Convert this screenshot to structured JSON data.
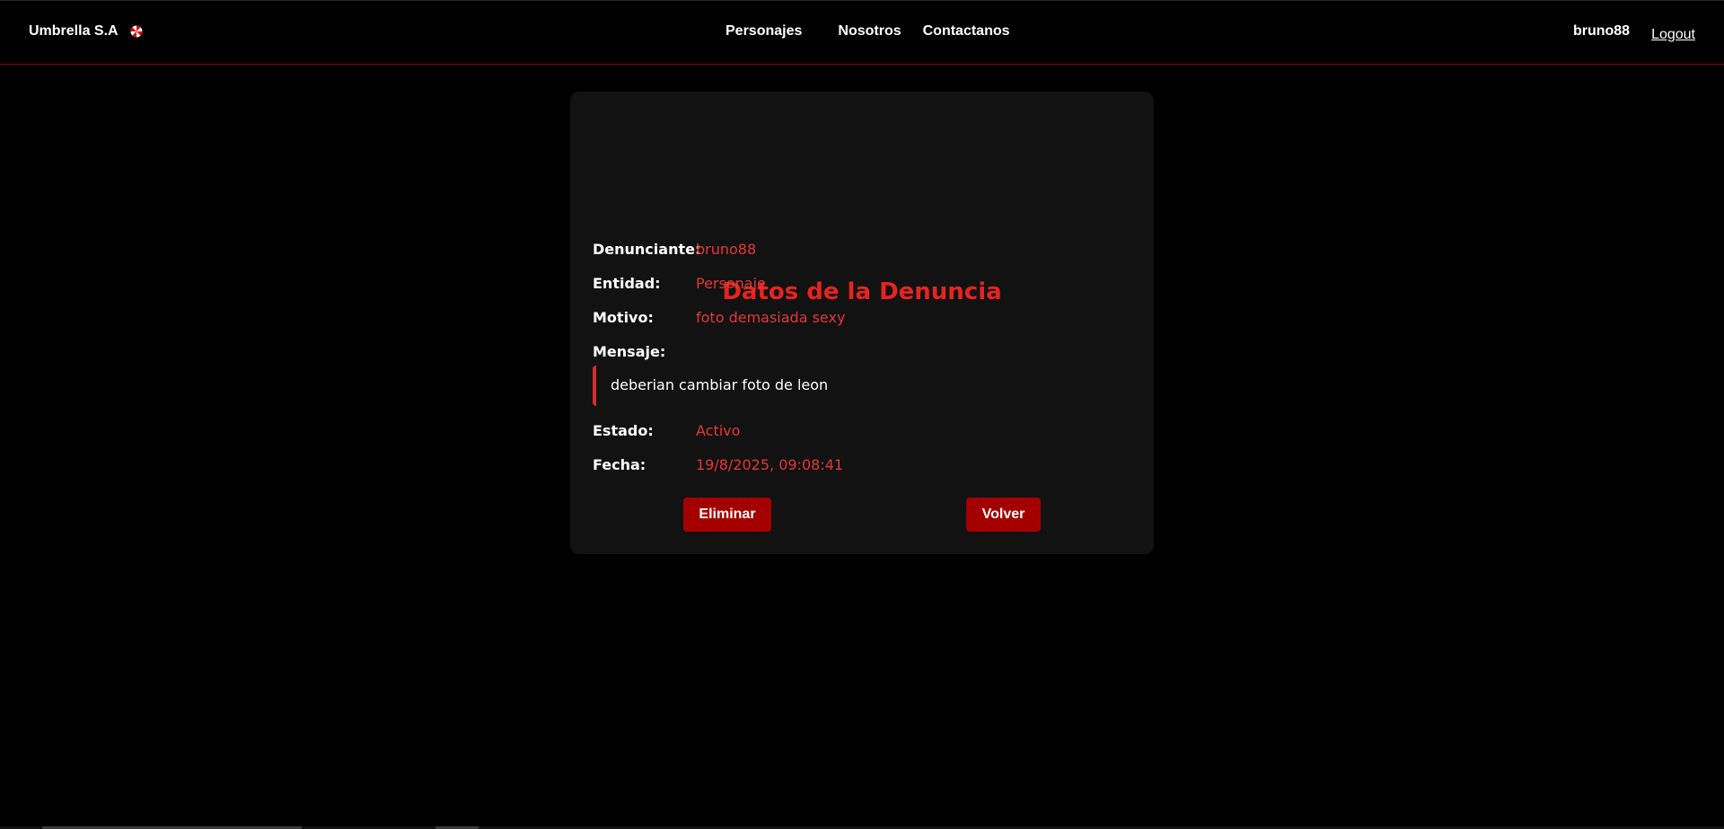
{
  "header": {
    "brand": "Umbrella S.A",
    "nav": [
      "Personajes",
      "Nosotros",
      "Contactanos"
    ],
    "username": "bruno88",
    "logout": "Logout"
  },
  "card": {
    "title": "Datos de la Denuncia",
    "fields": {
      "denunciante_label": "Denunciante:",
      "denunciante_value": "bruno88",
      "entidad_label": "Entidad:",
      "entidad_value": "Personaje",
      "motivo_label": "Motivo:",
      "motivo_value": "foto demasiada sexy",
      "mensaje_label": "Mensaje:",
      "mensaje_value": "deberian cambiar foto de leon",
      "estado_label": "Estado:",
      "estado_value": "Activo",
      "fecha_label": "Fecha:",
      "fecha_value": "19/8/2025, 09:08:41"
    },
    "buttons": {
      "delete": "Eliminar",
      "back": "Volver"
    }
  },
  "colors": {
    "accent": "#e52420",
    "button": "#a50000",
    "card_bg": "#121212",
    "page_bg": "#000000"
  }
}
